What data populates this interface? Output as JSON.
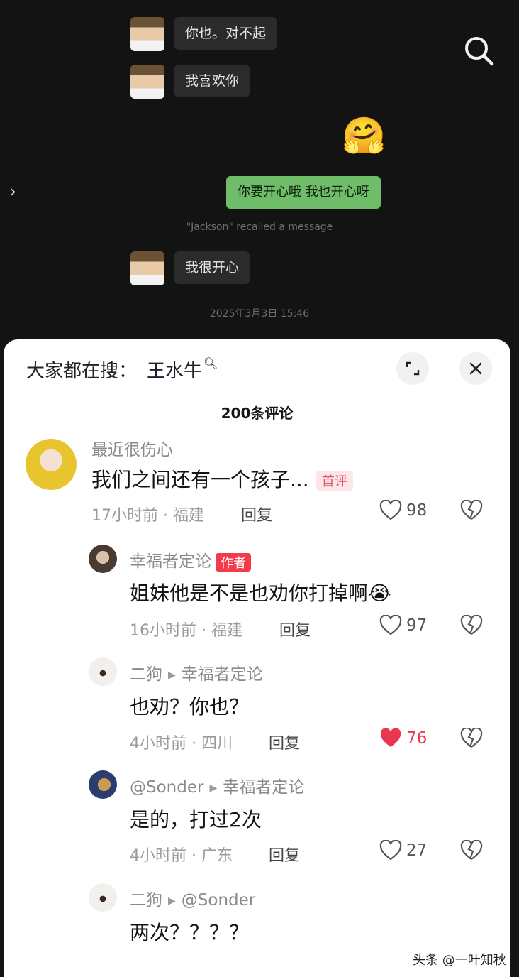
{
  "chat": {
    "messages": [
      {
        "side": "in",
        "text": "你也。对不起"
      },
      {
        "side": "in",
        "text": "我喜欢你"
      },
      {
        "side": "out",
        "emoji": "🤗"
      },
      {
        "side": "out",
        "text": "你要开心哦 我也开心呀"
      },
      {
        "system": "\"Jackson\" recalled a message"
      },
      {
        "side": "in",
        "text": "我很开心"
      },
      {
        "system": "2025年3月3日 15:46"
      }
    ]
  },
  "panel": {
    "hot_search_label": "大家都在搜：",
    "hot_search_keyword": "王水牛",
    "title": "200条评论"
  },
  "comments": [
    {
      "user": "最近很伤心",
      "text": "我们之间还有一个孩子...",
      "badge": "首评",
      "meta": "17小时前 · 福建",
      "reply": "回复",
      "likes": "98",
      "liked": false
    },
    {
      "user": "幸福者定论",
      "badge": "作者",
      "text": "姐妹他是不是也劝你打掉啊😭",
      "meta": "16小时前 · 福建",
      "reply": "回复",
      "likes": "97",
      "liked": false
    },
    {
      "user": "二狗",
      "reply_to": "幸福者定论",
      "text": "也劝？你也？",
      "meta": "4小时前 · 四川",
      "reply": "回复",
      "likes": "76",
      "liked": true
    },
    {
      "user": "@Sonder",
      "reply_to": "幸福者定论",
      "text": "是的，打过2次",
      "meta": "4小时前 · 广东",
      "reply": "回复",
      "likes": "27",
      "liked": false
    },
    {
      "user": "二狗",
      "reply_to": "@Sonder",
      "text": "两次？？？？"
    }
  ],
  "watermark": "头条 @一叶知秋",
  "colors": {
    "accent_red": "#f23b4b",
    "wechat_green": "#6fbd68",
    "like_red": "#e8384f"
  }
}
